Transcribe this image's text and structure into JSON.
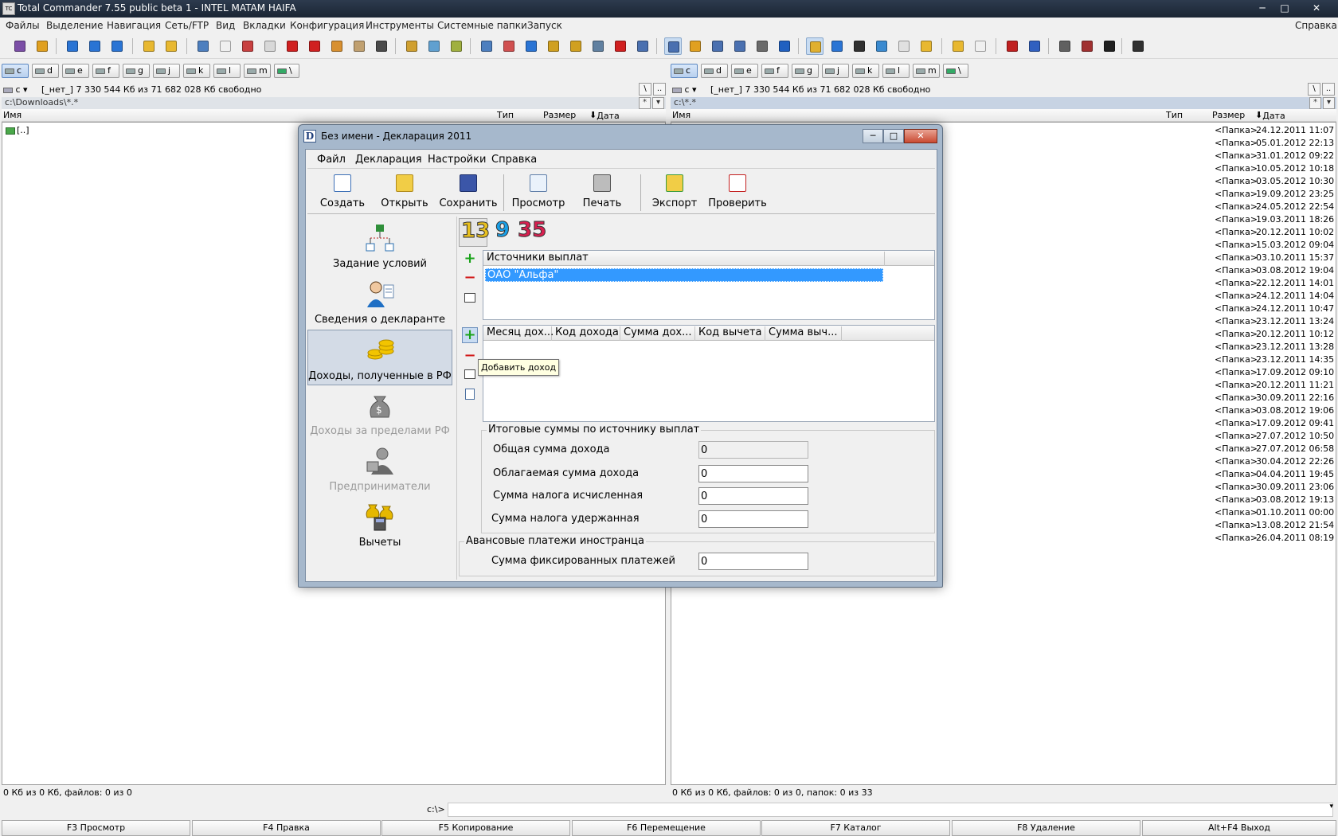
{
  "window": {
    "title": "Total Commander 7.55 public beta 1 - INTEL MATAM HAIFA",
    "icon_text": "TC"
  },
  "window_controls": {
    "minimize": "─",
    "maximize": "□",
    "close": "✕"
  },
  "menu": {
    "items": [
      "Файлы",
      "Выделение",
      "Навигация",
      "Сеть/FTP",
      "Вид",
      "Вкладки",
      "Конфигурация",
      "Инструменты",
      "Системные папки",
      "Запуск"
    ],
    "help": "Справка"
  },
  "toolbar": {
    "icons": [
      "refresh-icon",
      "shield-icon",
      "back-icon",
      "forward-icon",
      "sync-icon",
      "folder-icon",
      "folder-tree-icon",
      "search-icon",
      "file-icon",
      "checklist-icon",
      "blank-icon",
      "asterisk-icon",
      "ext-icon",
      "pack-icon",
      "clipboard-icon",
      "edit-icon",
      "group-icon",
      "tree-icon",
      "tree2-icon",
      "copy-icon",
      "copy2-icon",
      "download-icon",
      "lock-icon",
      "lock2-icon",
      "link-icon",
      "delete-icon",
      "compare-icon",
      "list-view-icon",
      "tree-view-icon",
      "columns-icon",
      "grid-icon",
      "thumbs-icon",
      "window-icon",
      "notes-icon",
      "music-icon",
      "film-icon",
      "image-icon",
      "document-icon",
      "box-icon",
      "folder2-icon",
      "page-icon",
      "ftp-icon",
      "url-icon",
      "tool-icon",
      "tool2-icon",
      "linux-icon",
      "7z-icon"
    ],
    "colors": [
      "#7b4ea6",
      "#e0a020",
      "#2a74d4",
      "#2a74d4",
      "#2a74d4",
      "#e8b830",
      "#e8b830",
      "#4d7fbf",
      "#f0f0f0",
      "#c84040",
      "#d8d8d8",
      "#d02020",
      "#d02020",
      "#d89030",
      "#c0a070",
      "#4a4a4a",
      "#d0a030",
      "#60a0d0",
      "#a0b040",
      "#4d7fbf",
      "#d05050",
      "#2a74d4",
      "#d0a020",
      "#d0a020",
      "#6080a0",
      "#d02020",
      "#4a70b0",
      "#4a70b0",
      "#e0a020",
      "#4a70b0",
      "#4a70b0",
      "#6a6a6a",
      "#2060c0",
      "#e0b030",
      "#2a74d4",
      "#303030",
      "#3a8ad0",
      "#e0e0e0",
      "#e8b830",
      "#e8b830",
      "#f0f0f0",
      "#c02020",
      "#3060c0",
      "#606060",
      "#a03030",
      "#202020",
      "#303030"
    ]
  },
  "drives": [
    "c",
    "d",
    "e",
    "f",
    "g",
    "j",
    "k",
    "l",
    "m",
    "\\"
  ],
  "left_panel": {
    "drive_select": "c",
    "free_space": "[_нет_]  7 330 544 Кб из 71 682 028 Кб свободно",
    "root_btn": "\\",
    "up_btn": "..",
    "path": "c:\\Downloads\\*.*",
    "hist_btn": "*",
    "drop_btn": "▾",
    "col_name": "Имя",
    "col_type": "Тип",
    "col_size": "Размер",
    "col_date": "Дата",
    "items": [
      {
        "name": "[..]"
      }
    ],
    "status": "0 Кб из 0 Кб, файлов: 0 из 0"
  },
  "right_panel": {
    "drive_select": "c",
    "free_space": "[_нет_]  7 330 544 Кб из 71 682 028 Кб свободно",
    "root_btn": "\\",
    "up_btn": "..",
    "path": "c:\\*.*",
    "hist_btn": "*",
    "drop_btn": "▾",
    "col_name": "Имя",
    "col_type": "Тип",
    "col_size": "Размер",
    "col_date": "Дата",
    "rows": [
      {
        "size": "<Папка>",
        "date": "24.12.2011 11:07"
      },
      {
        "size": "<Папка>",
        "date": "05.01.2012 22:13"
      },
      {
        "size": "<Папка>",
        "date": "31.01.2012 09:22"
      },
      {
        "size": "<Папка>",
        "date": "10.05.2012 10:18"
      },
      {
        "size": "<Папка>",
        "date": "03.05.2012 10:30"
      },
      {
        "size": "<Папка>",
        "date": "19.09.2012 23:25"
      },
      {
        "size": "<Папка>",
        "date": "24.05.2012 22:54"
      },
      {
        "size": "<Папка>",
        "date": "19.03.2011 18:26"
      },
      {
        "size": "<Папка>",
        "date": "20.12.2011 10:02"
      },
      {
        "size": "<Папка>",
        "date": "15.03.2012 09:04"
      },
      {
        "size": "<Папка>",
        "date": "03.10.2011 15:37"
      },
      {
        "size": "<Папка>",
        "date": "03.08.2012 19:04"
      },
      {
        "size": "<Папка>",
        "date": "22.12.2011 14:01"
      },
      {
        "size": "<Папка>",
        "date": "24.12.2011 14:04"
      },
      {
        "size": "<Папка>",
        "date": "24.12.2011 10:47"
      },
      {
        "size": "<Папка>",
        "date": "23.12.2011 13:24"
      },
      {
        "size": "<Папка>",
        "date": "20.12.2011 10:12"
      },
      {
        "size": "<Папка>",
        "date": "23.12.2011 13:28"
      },
      {
        "size": "<Папка>",
        "date": "23.12.2011 14:35"
      },
      {
        "size": "<Папка>",
        "date": "17.09.2012 09:10"
      },
      {
        "size": "<Папка>",
        "date": "20.12.2011 11:21"
      },
      {
        "size": "<Папка>",
        "date": "30.09.2011 22:16"
      },
      {
        "size": "<Папка>",
        "date": "03.08.2012 19:06"
      },
      {
        "size": "<Папка>",
        "date": "17.09.2012 09:41"
      },
      {
        "size": "<Папка>",
        "date": "27.07.2012 10:50"
      },
      {
        "size": "<Папка>",
        "date": "27.07.2012 06:58"
      },
      {
        "size": "<Папка>",
        "date": "30.04.2012 22:26"
      },
      {
        "size": "<Папка>",
        "date": "04.04.2011 19:45"
      },
      {
        "size": "<Папка>",
        "date": "30.09.2011 23:06"
      },
      {
        "size": "<Папка>",
        "date": "03.08.2012 19:13"
      },
      {
        "size": "<Папка>",
        "date": "01.10.2011 00:00"
      },
      {
        "size": "<Папка>",
        "date": "13.08.2012 21:54"
      },
      {
        "size": "<Папка>",
        "date": "26.04.2011 08:19"
      }
    ],
    "status": "0 Кб из 0 Кб, файлов: 0 из 0, папок: 0 из 33"
  },
  "cmdline": {
    "prompt": "c:\\>",
    "value": "",
    "drop": "▾"
  },
  "fkeys": [
    "F3 Просмотр",
    "F4 Правка",
    "F5 Копирование",
    "F6 Перемещение",
    "F7 Каталог",
    "F8 Удаление",
    "Alt+F4 Выход"
  ],
  "dialog": {
    "title": "Без имени - Декларация 2011",
    "icon_letter": "D",
    "controls": {
      "minimize": "─",
      "maximize": "□",
      "close": "✕"
    },
    "menu": [
      "Файл",
      "Декларация",
      "Настройки",
      "Справка"
    ],
    "tools": [
      "Создать",
      "Открыть",
      "Сохранить",
      "Просмотр",
      "Печать",
      "Экспорт",
      "Проверить"
    ],
    "nav": [
      {
        "label": "Задание условий",
        "state": "normal"
      },
      {
        "label": "Сведения о декларанте",
        "state": "normal"
      },
      {
        "label": "Доходы, полученные в РФ",
        "state": "active"
      },
      {
        "label": "Доходы за пределами РФ",
        "state": "disabled"
      },
      {
        "label": "Предприниматели",
        "state": "disabled"
      },
      {
        "label": "Вычеты",
        "state": "normal"
      }
    ],
    "rates": [
      "13",
      "9",
      "35"
    ],
    "rate_colors": [
      "#e8c020",
      "#1aa0e8",
      "#d82050"
    ],
    "btn": {
      "plus": "+",
      "minus": "−"
    },
    "sources_header": "Источники выплат",
    "sources": [
      "ОАО \"Альфа\""
    ],
    "income_columns": [
      "Месяц дох...",
      "Код дохода",
      "Сумма дох...",
      "Код вычета",
      "Сумма выч..."
    ],
    "tooltip": "Добавить доход",
    "totals": {
      "title": "Итоговые суммы по источнику выплат",
      "fields": [
        {
          "label": "Общая сумма дохода",
          "value": "0"
        },
        {
          "label": "Облагаемая сумма дохода",
          "value": "0"
        },
        {
          "label": "Сумма налога исчисленная",
          "value": "0"
        },
        {
          "label": "Сумма налога удержанная",
          "value": "0"
        }
      ]
    },
    "advance": {
      "title": "Авансовые платежи иностранца",
      "field_label": "Сумма фиксированных платежей",
      "field_value": "0"
    }
  }
}
